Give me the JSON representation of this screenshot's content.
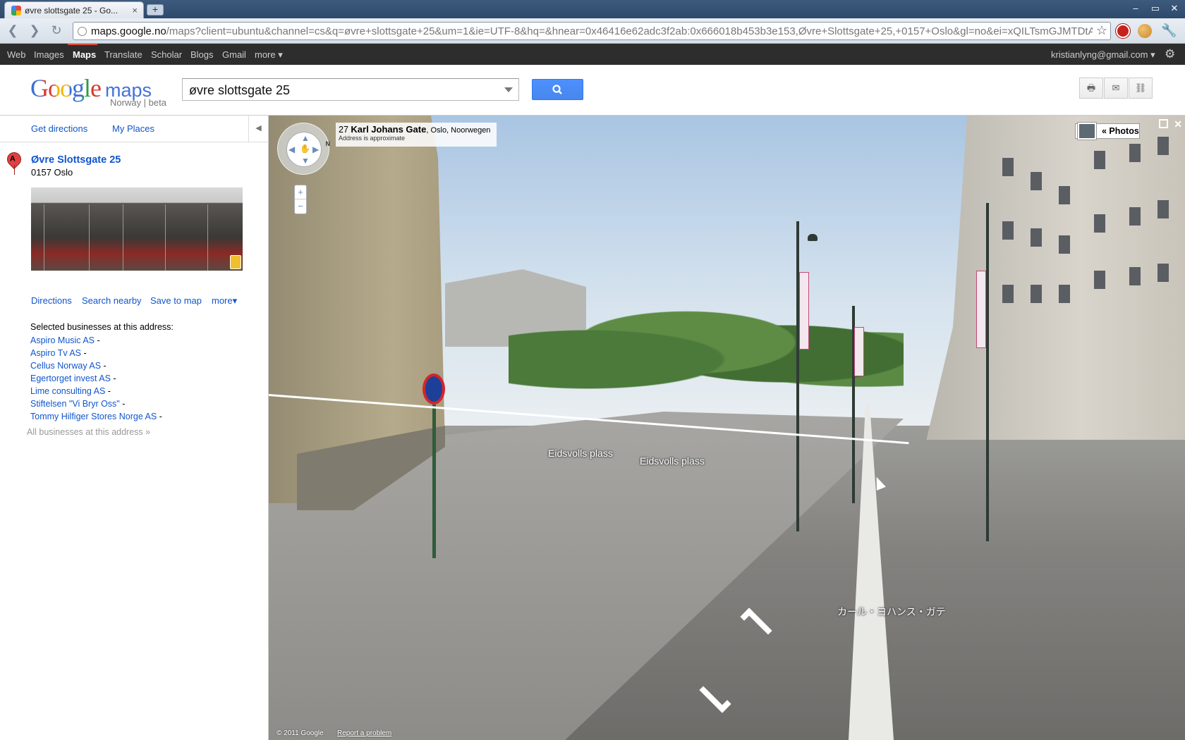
{
  "browser": {
    "tab_title": "øvre slottsgate 25 - Go...",
    "tab_close": "×",
    "new_tab": "+",
    "url_host": "maps.google.no",
    "url_path": "/maps?client=ubuntu&channel=cs&q=øvre+slottsgate+25&um=1&ie=UTF-8&hq=&hnear=0x46416e62adc3f2ab:0x666018b453b3e153,Øvre+Slottsgate+25,+0157+Oslo&gl=no&ei=xQILTsmGJMTDtAaj",
    "icons": [
      "back-icon",
      "forward-icon",
      "reload-icon",
      "globe-icon",
      "star-icon",
      "adblock-icon",
      "cookie-icon",
      "wrench-icon"
    ],
    "window_buttons": [
      "–",
      "▭",
      "✕"
    ]
  },
  "gbar": {
    "items": [
      "Web",
      "Images",
      "Maps",
      "Translate",
      "Scholar",
      "Blogs",
      "Gmail",
      "more ▾"
    ],
    "account": "kristianlyng@gmail.com ▾"
  },
  "header": {
    "logo_google": "Google",
    "logo_maps": "maps",
    "sublogo": "Norway | beta",
    "search_value": "øvre slottsgate 25",
    "search_button_icon": "magnifier-icon",
    "buttons": [
      "🖶",
      "✉",
      "⛓"
    ]
  },
  "panel": {
    "top_links": [
      "Get directions",
      "My Places"
    ],
    "result_marker": "A",
    "result_title": "Øvre Slottsgate 25",
    "result_address": "0157 Oslo",
    "actions": [
      "Directions",
      "Search nearby",
      "Save to map",
      "more▾"
    ],
    "businesses_heading": "Selected businesses at this address:",
    "businesses": [
      "Aspiro Music AS",
      "Aspiro Tv AS",
      "Cellus Norway AS",
      "Egertorget invest AS",
      "Lime consulting AS",
      "Stiftelsen \"Vi Bryr Oss\"",
      "Tommy Hilfiger Stores Norge AS"
    ],
    "business_suffix": " -",
    "all_businesses": "All businesses at this address »"
  },
  "streetview": {
    "addr_number": "27",
    "addr_street": "Karl Johans Gate",
    "addr_city": ", Oslo, Noorwegen",
    "addr_note": "Address is approximate",
    "photos_label": "« Photos",
    "close_label": "✕",
    "label_1": "Eidsvolls plass",
    "label_2": "Eidsvolls plass",
    "label_3": "カール・ヨハンス・ガテ",
    "copyright": "© 2011 Google",
    "report": "Report a problem",
    "zoom_in": "+",
    "zoom_out": "−",
    "compass_n": "N"
  }
}
